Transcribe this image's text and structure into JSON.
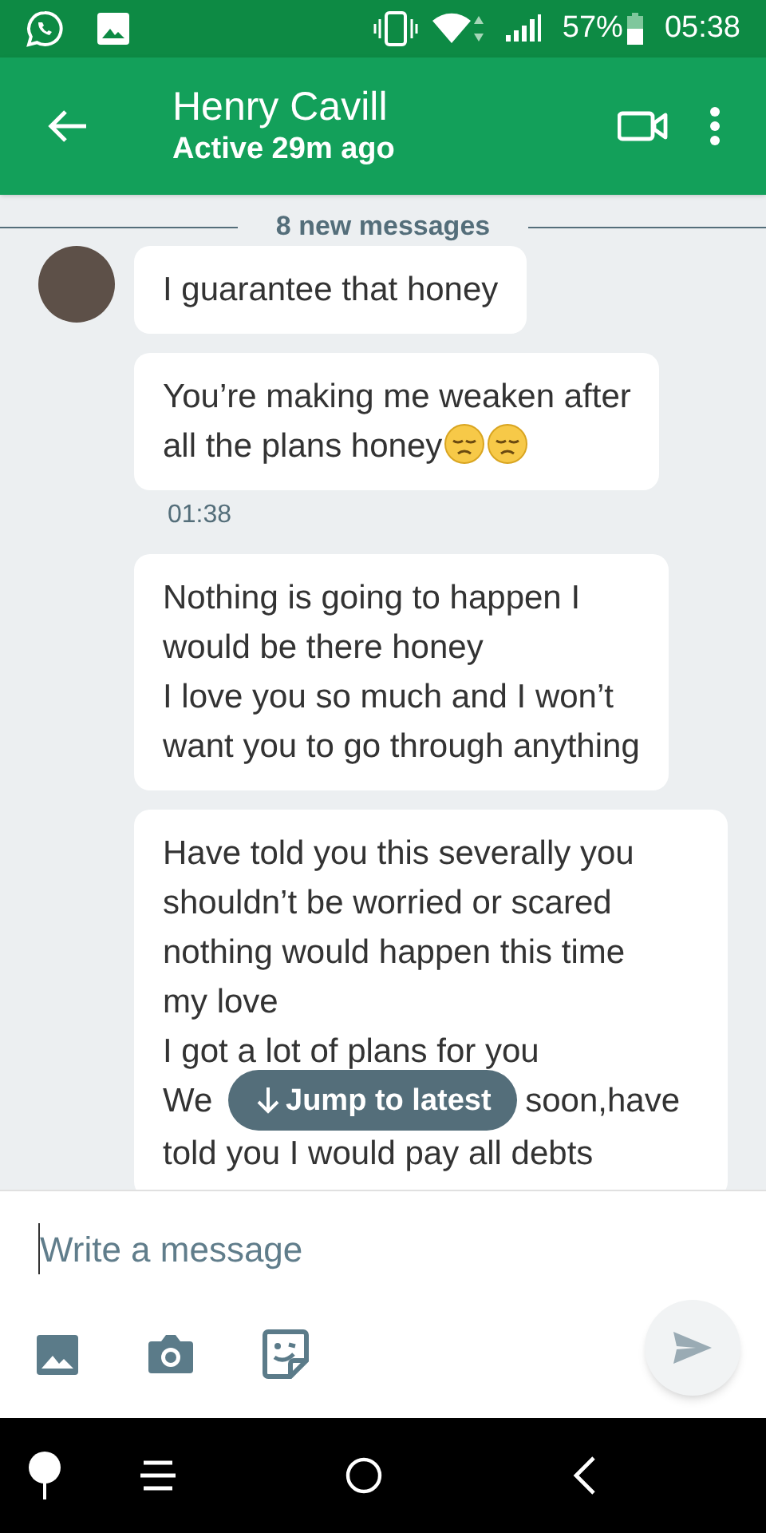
{
  "status_bar": {
    "battery": "57%",
    "time": "05:38"
  },
  "header": {
    "title": "Henry Cavill",
    "subtitle": "Active 29m ago"
  },
  "divider": "8 new messages",
  "messages": [
    {
      "text": "I guarantee that honey",
      "avatar": true,
      "pensive_emojis": false
    },
    {
      "text": "You’re making me weaken after\nall the plans honey",
      "avatar": false,
      "pensive_emojis": true,
      "time": "01:38"
    },
    {
      "text": "Nothing is going to happen I\nwould be there honey\nI love you so much and I won’t\nwant you to go through anything",
      "avatar": false,
      "pensive_emojis": false
    },
    {
      "text": "Have told you this severally you\nshouldn’t be worried or scared\nnothing would happen this time\nmy love\nI got a lot of plans for you",
      "covered_left": "We",
      "covered_right": "soon,have",
      "tail": "told you I would pay all debts",
      "avatar": false
    }
  ],
  "jump_button": "Jump to latest",
  "composer": {
    "placeholder": "Write a message"
  }
}
